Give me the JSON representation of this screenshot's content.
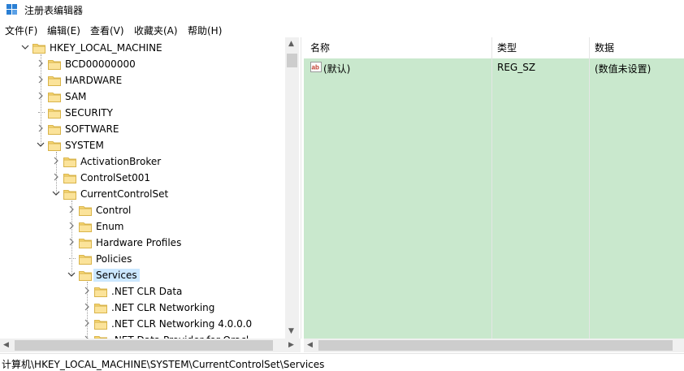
{
  "window": {
    "title": "注册表编辑器"
  },
  "menu": [
    "文件(F)",
    "编辑(E)",
    "查看(V)",
    "收藏夹(A)",
    "帮助(H)"
  ],
  "tree": [
    {
      "label": "HKEY_LOCAL_MACHINE",
      "expanded": true,
      "icon": "folder-icon"
    },
    {
      "label": "BCD00000000",
      "expanded": false
    },
    {
      "label": "HARDWARE",
      "expanded": false
    },
    {
      "label": "SAM",
      "expanded": false
    },
    {
      "label": "SECURITY",
      "expanded": false
    },
    {
      "label": "SOFTWARE",
      "expanded": false
    },
    {
      "label": "SYSTEM",
      "expanded": true
    },
    {
      "label": "ActivationBroker",
      "expanded": false
    },
    {
      "label": "ControlSet001",
      "expanded": false
    },
    {
      "label": "CurrentControlSet",
      "expanded": true
    },
    {
      "label": "Control",
      "expanded": false
    },
    {
      "label": "Enum",
      "expanded": false
    },
    {
      "label": "Hardware Profiles",
      "expanded": false
    },
    {
      "label": "Policies",
      "expanded": false
    },
    {
      "label": "Services",
      "expanded": true,
      "selected": true
    },
    {
      "label": ".NET CLR Data",
      "expanded": false
    },
    {
      "label": ".NET CLR Networking",
      "expanded": false
    },
    {
      "label": ".NET CLR Networking 4.0.0.0",
      "expanded": false
    },
    {
      "label": ".NET Data Provider for Oracl",
      "expanded": false
    }
  ],
  "list": {
    "columns": [
      "名称",
      "类型",
      "数据"
    ],
    "rows": [
      {
        "name": "(默认)",
        "type": "REG_SZ",
        "data": "(数值未设置)",
        "icon": "string-value-icon"
      }
    ]
  },
  "status": {
    "path": "计算机\\HKEY_LOCAL_MACHINE\\SYSTEM\\CurrentControlSet\\Services"
  },
  "colors": {
    "selection": "#cce8ff",
    "list_background": "#c9e8cd",
    "folder": "#f8d775"
  }
}
